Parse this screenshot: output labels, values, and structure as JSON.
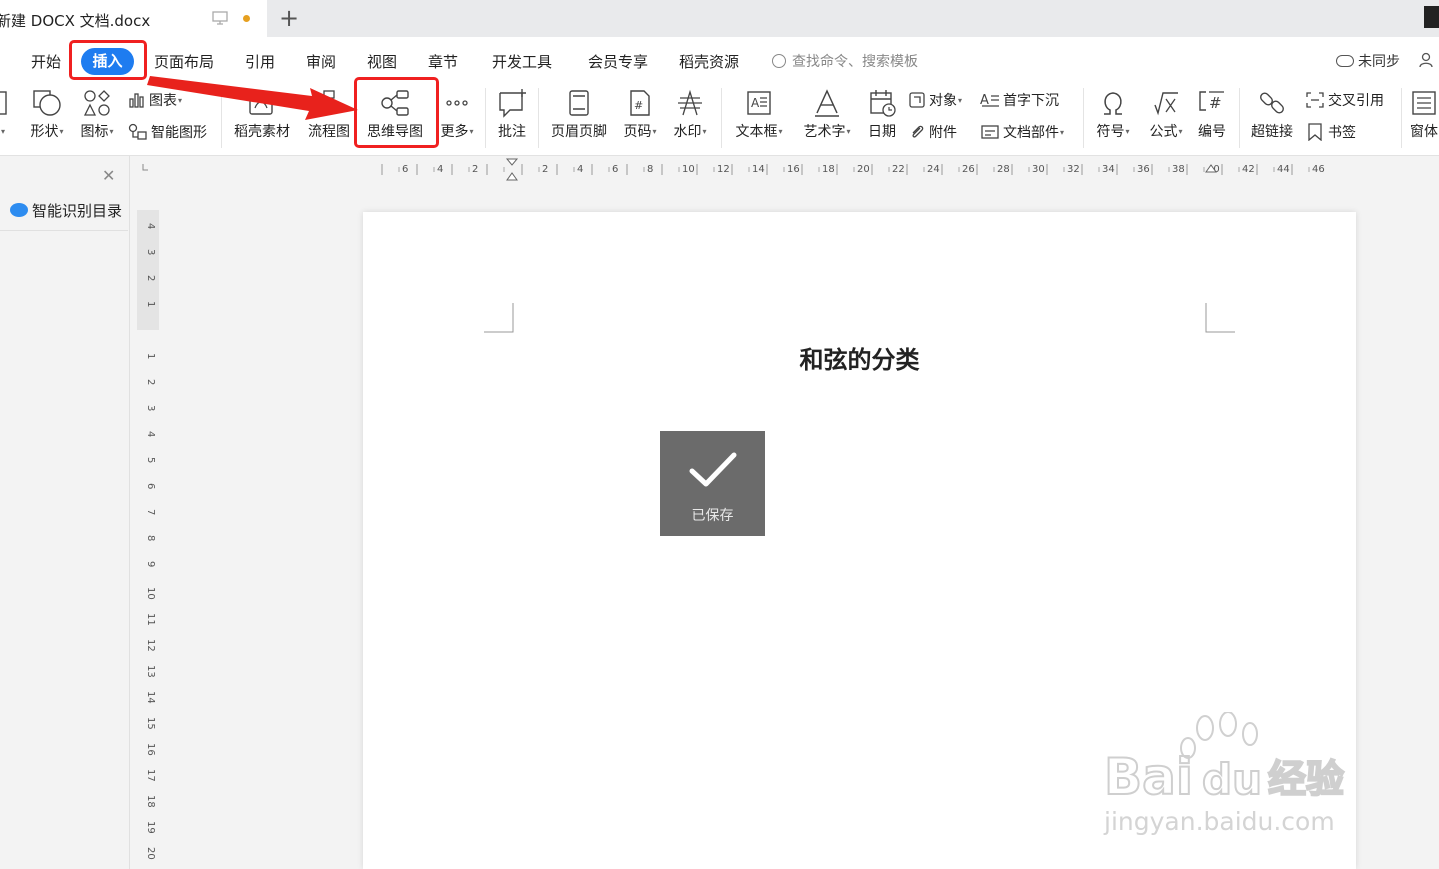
{
  "titlebar": {
    "doc_name": "新建 DOCX 文档.docx",
    "new_tab": "+"
  },
  "menu": {
    "items": [
      "开始",
      "插入",
      "页面布局",
      "引用",
      "审阅",
      "视图",
      "章节",
      "开发工具",
      "会员专享",
      "稻壳资源"
    ],
    "active": "插入",
    "search_placeholder": "查找命令、搜索模板",
    "sync_label": "未同步"
  },
  "ribbon": {
    "shape": "形状",
    "icon": "图标",
    "chart": "图表",
    "smart_shape": "智能图形",
    "docer_material": "稻壳素材",
    "flowchart": "流程图",
    "mindmap": "思维导图",
    "more": "更多",
    "comment": "批注",
    "header_footer": "页眉页脚",
    "page_number": "页码",
    "watermark": "水印",
    "textbox": "文本框",
    "wordart": "艺术字",
    "date": "日期",
    "object": "对象",
    "attachment": "附件",
    "dropcap": "首字下沉",
    "doc_parts": "文档部件",
    "symbol": "符号",
    "formula": "公式",
    "numbering": "编号",
    "hyperlink": "超链接",
    "cross_ref": "交叉引用",
    "bookmark": "书签",
    "form": "窗体"
  },
  "left_panel": {
    "title": "智能识别目录"
  },
  "document": {
    "title": "和弦的分类"
  },
  "toast": {
    "message": "已保存"
  },
  "watermark": {
    "brand": "Bai",
    "brand2": "du",
    "cn": "经验",
    "url": "jingyan.baidu.com"
  },
  "colors": {
    "accent": "#1e7cf0",
    "highlight": "#f02020"
  }
}
